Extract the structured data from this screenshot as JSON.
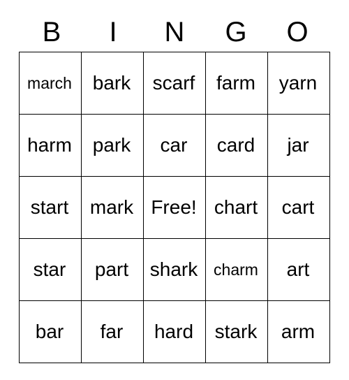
{
  "header": {
    "letters": [
      "B",
      "I",
      "N",
      "G",
      "O"
    ]
  },
  "grid": {
    "rows": [
      [
        "march",
        "bark",
        "scarf",
        "farm",
        "yarn"
      ],
      [
        "harm",
        "park",
        "car",
        "card",
        "jar"
      ],
      [
        "start",
        "mark",
        "Free!",
        "chart",
        "cart"
      ],
      [
        "star",
        "part",
        "shark",
        "charm",
        "art"
      ],
      [
        "bar",
        "far",
        "hard",
        "stark",
        "arm"
      ]
    ]
  }
}
